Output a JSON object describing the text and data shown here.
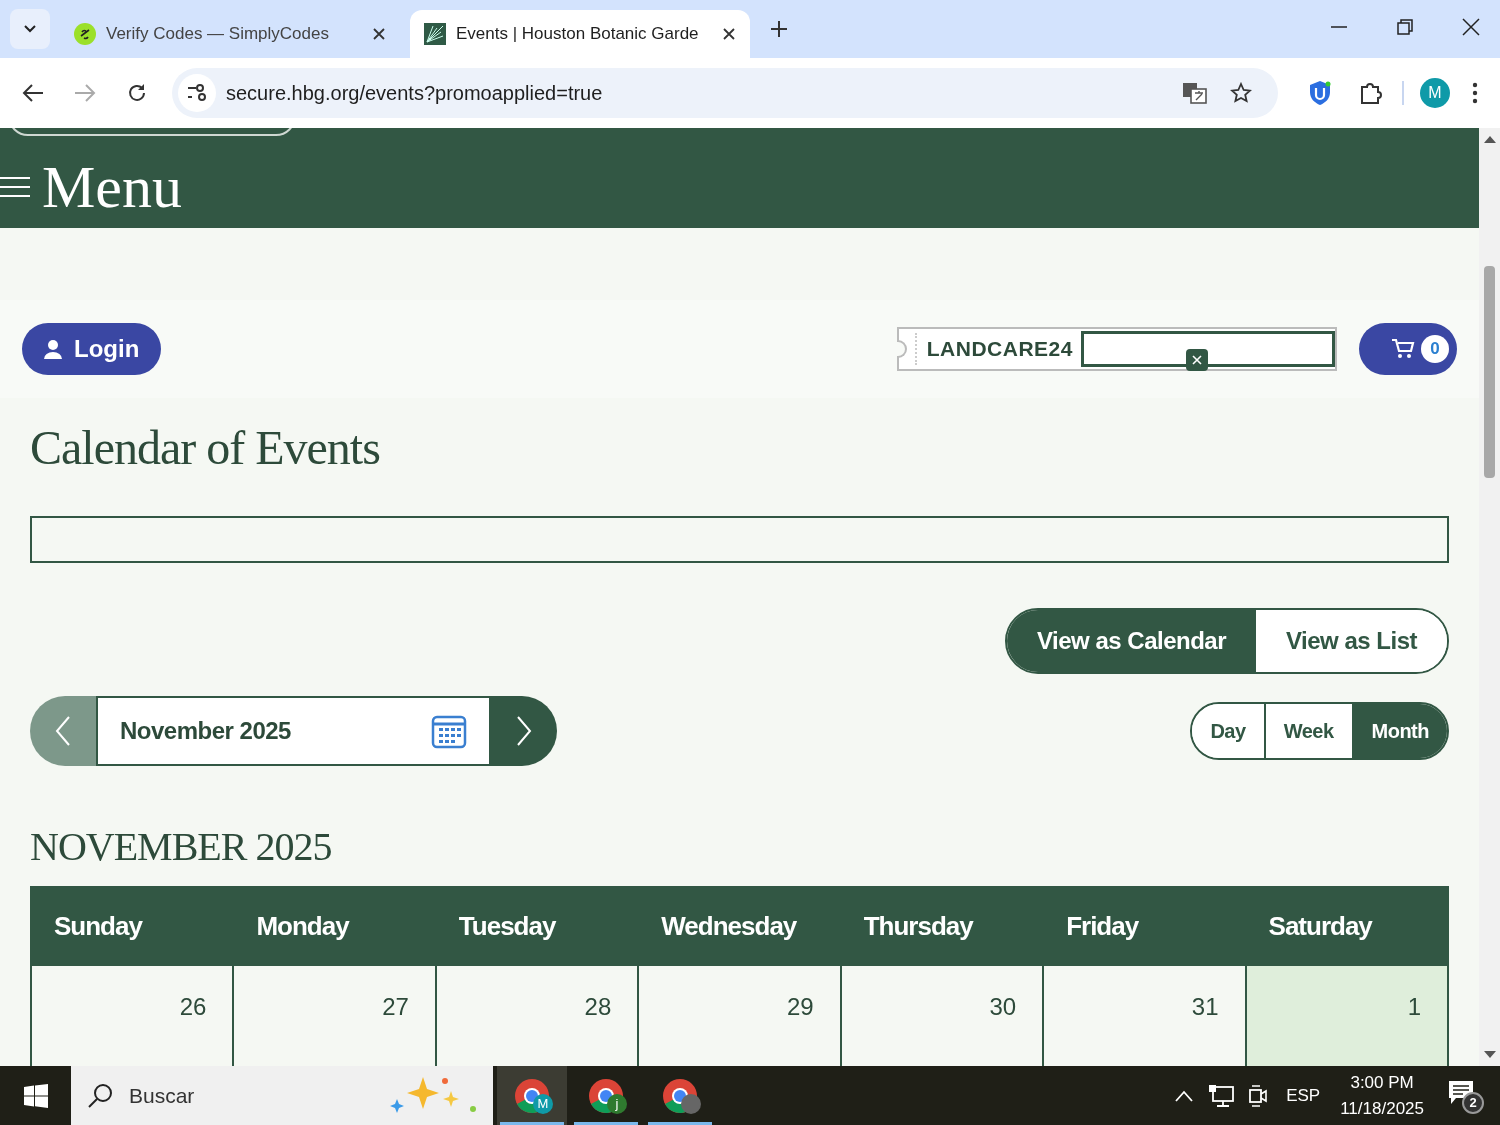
{
  "browser": {
    "tabs": [
      {
        "title": "Verify Codes — SimplyCodes",
        "selected": false
      },
      {
        "title": "Events | Houston Botanic Garde",
        "selected": true
      }
    ],
    "url": "secure.hbg.org/events?promoapplied=true",
    "profile": "M"
  },
  "header": {
    "menu_label": "Menu"
  },
  "account": {
    "login": "Login",
    "promo_code": "LANDCARE24",
    "cart_count": "0"
  },
  "heading": "Calendar of Events",
  "view_modes": [
    {
      "label": "View as Calendar",
      "selected": true
    },
    {
      "label": "View as List",
      "selected": false
    }
  ],
  "month_picker": {
    "label": "November 2025"
  },
  "ranges": [
    {
      "label": "Day",
      "selected": false
    },
    {
      "label": "Week",
      "selected": false
    },
    {
      "label": "Month",
      "selected": true
    }
  ],
  "month_title": "NOVEMBER 2025",
  "weekdays": [
    "Sunday",
    "Monday",
    "Tuesday",
    "Wednesday",
    "Thursday",
    "Friday",
    "Saturday"
  ],
  "days": [
    {
      "label": "26",
      "in_month": false
    },
    {
      "label": "27",
      "in_month": false
    },
    {
      "label": "28",
      "in_month": false
    },
    {
      "label": "29",
      "in_month": false
    },
    {
      "label": "30",
      "in_month": false
    },
    {
      "label": "31",
      "in_month": false
    },
    {
      "label": "1",
      "in_month": true
    }
  ],
  "taskbar": {
    "search_placeholder": "Buscar",
    "apps": [
      {
        "badge": "M",
        "selected": true
      },
      {
        "badge": "j",
        "selected": false
      },
      {
        "selected": false
      }
    ],
    "language": "ESP",
    "time": "3:00 PM",
    "date": "11/18/2025",
    "notifications": "2"
  }
}
